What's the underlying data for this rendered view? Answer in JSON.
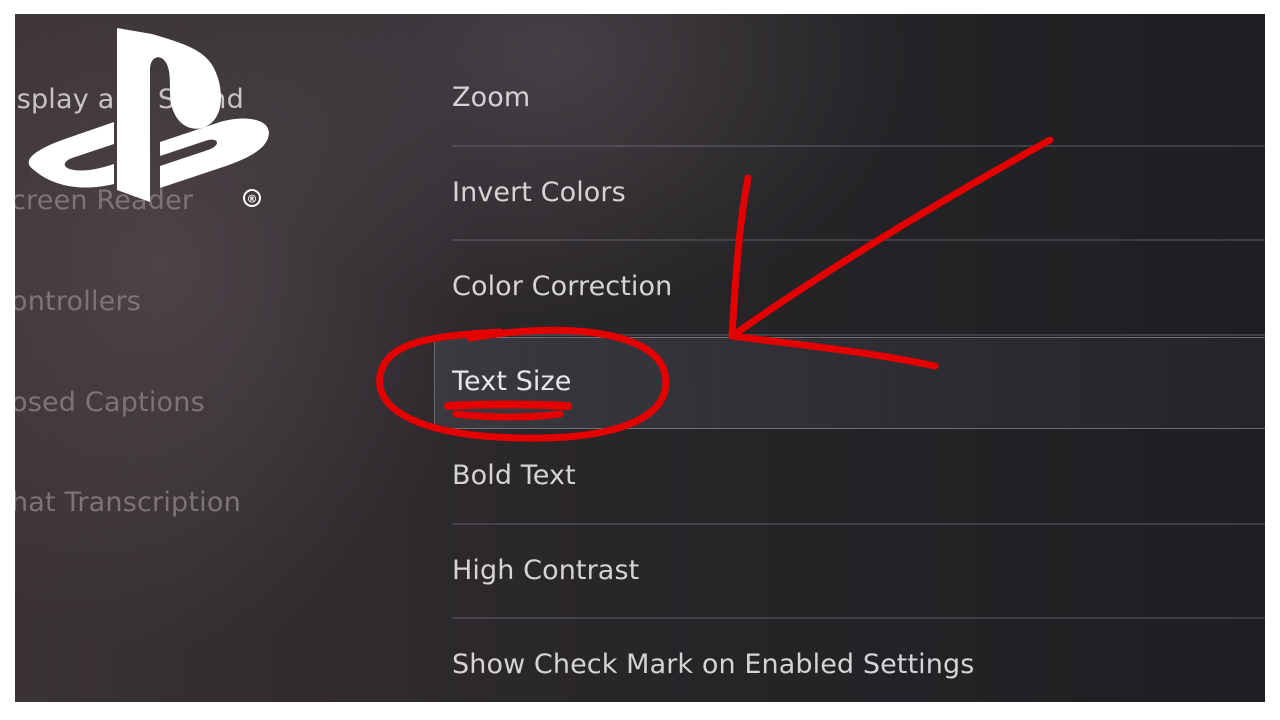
{
  "sidebar": {
    "items": [
      {
        "label": "isplay and Sound",
        "state": "active"
      },
      {
        "label": "creen Reader",
        "state": "dim"
      },
      {
        "label": "ontrollers",
        "state": "dim"
      },
      {
        "label": "osed Captions",
        "state": "dim"
      },
      {
        "label": "hat Transcription",
        "state": "dim"
      }
    ]
  },
  "menu": {
    "items": [
      {
        "label": "Zoom"
      },
      {
        "label": "Invert Colors"
      },
      {
        "label": "Color Correction"
      },
      {
        "label": "Text Size",
        "selected": true
      },
      {
        "label": "Bold Text"
      },
      {
        "label": "High Contrast"
      },
      {
        "label": "Show Check Mark on Enabled Settings"
      }
    ]
  },
  "annotation": {
    "color": "#e50000",
    "shapes": [
      "arrow",
      "circle",
      "underline"
    ]
  },
  "logo": {
    "icon": "playstation-logo-icon",
    "registered_mark": "®"
  },
  "colors": {
    "background": "#262427",
    "menu_text": "#d6d3d6",
    "sidebar_text": "#7e7478"
  }
}
